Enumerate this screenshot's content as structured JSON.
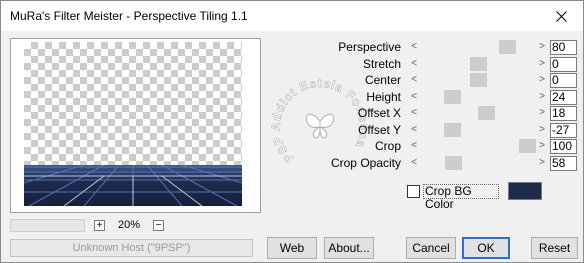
{
  "window": {
    "title": "MuRa's Filter Meister - Perspective Tiling 1.1",
    "close_glyph": "close-icon"
  },
  "preview": {
    "zoom_minus": "+",
    "zoom_value": "20%",
    "zoom_plus": "−",
    "host_text": "Unknown Host (\"9PSP\")"
  },
  "watermark": {
    "text": "PSP Addict Estela Fonseca"
  },
  "params": [
    {
      "label": "Perspective",
      "value": "80",
      "level": 0.8
    },
    {
      "label": "Stretch",
      "value": "0",
      "level": 0.5
    },
    {
      "label": "Center",
      "value": "0",
      "level": 0.5
    },
    {
      "label": "Height",
      "value": "24",
      "level": 0.24
    },
    {
      "label": "Offset X",
      "value": "18",
      "level": 0.59
    },
    {
      "label": "Offset Y",
      "value": "-27",
      "level": 0.24
    },
    {
      "label": "Crop",
      "value": "100",
      "level": 1.0
    },
    {
      "label": "Crop Opacity",
      "value": "58",
      "level": 0.25
    }
  ],
  "crop_bg": {
    "label": "Crop BG Color",
    "checked": false,
    "color": "#1c2c4a"
  },
  "buttons": {
    "web": "Web",
    "about": "About...",
    "cancel": "Cancel",
    "ok": "OK",
    "reset": "Reset"
  },
  "colors": {
    "accent": "#2a6fd0",
    "floor": "#1d2b4f"
  }
}
